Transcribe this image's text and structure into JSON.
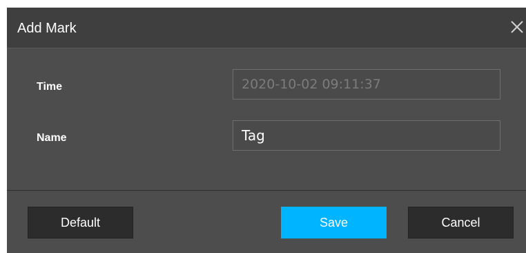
{
  "dialog": {
    "title": "Add Mark",
    "close_icon": "close-icon"
  },
  "form": {
    "time_label": "Time",
    "time_value": "2020-10-02 09:11:37",
    "name_label": "Name",
    "name_value": "Tag"
  },
  "buttons": {
    "default_label": "Default",
    "save_label": "Save",
    "cancel_label": "Cancel"
  },
  "colors": {
    "dialog_bg": "#4d4d4d",
    "titlebar_bg": "#3f3f3f",
    "accent": "#00b4ff",
    "button_bg": "#2c2c2c"
  }
}
